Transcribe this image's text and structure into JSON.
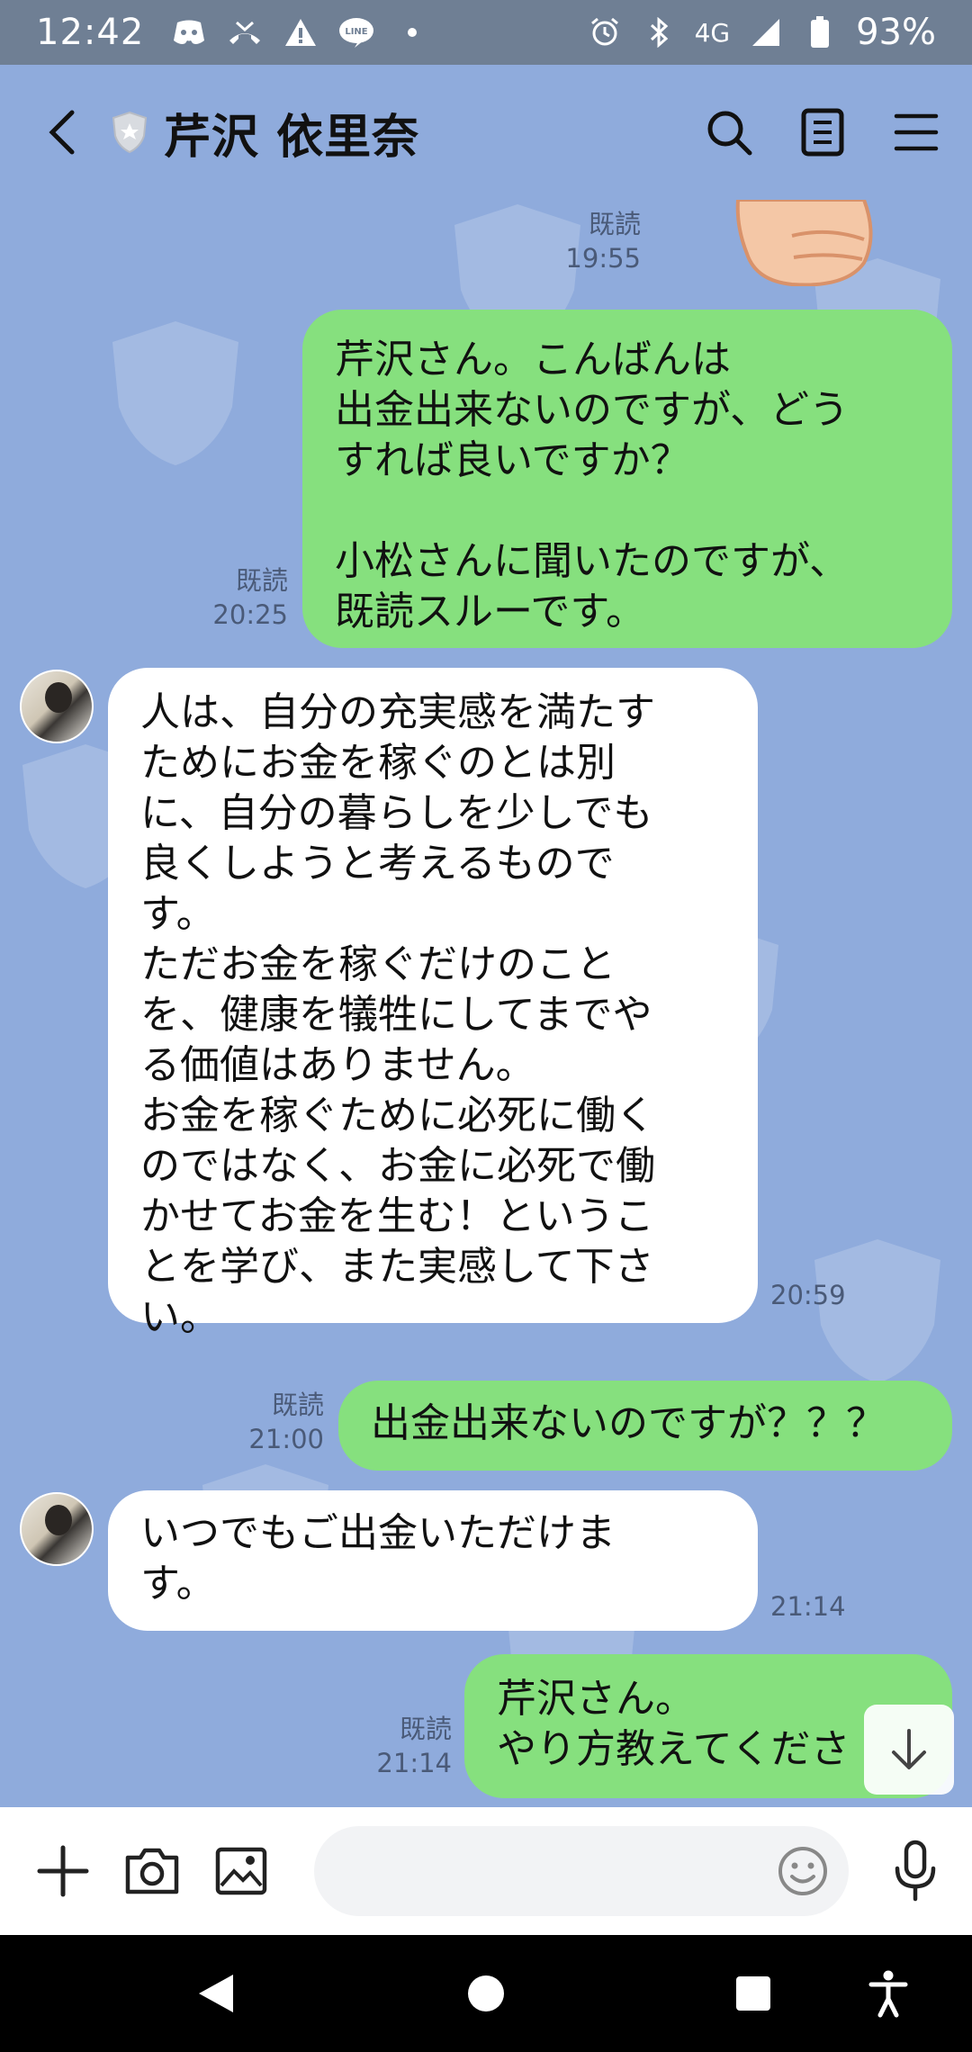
{
  "status_bar": {
    "time": "12:42",
    "network": "4G",
    "battery": "93%",
    "left_icons": [
      "discord-icon",
      "missed-call-icon",
      "warning-icon",
      "line-icon",
      "dot-icon"
    ],
    "right_icons": [
      "alarm-icon",
      "bluetooth-icon",
      "signal-icon",
      "battery-icon"
    ]
  },
  "header": {
    "title": "芹沢 依里奈",
    "actions": [
      "search-icon",
      "notes-icon",
      "menu-icon"
    ]
  },
  "messages": [
    {
      "side": "out",
      "read": "既読",
      "time": "19:55",
      "text": ""
    },
    {
      "side": "out",
      "read": "既読",
      "time": "20:25",
      "text": "芹沢さん。こんばんは\n出金出来ないのですが、どう\nすれば良いですか？\n\n小松さんに聞いたのですが、\n既読スルーです。"
    },
    {
      "side": "in",
      "time": "20:59",
      "text": "人は、自分の充実感を満たす\nためにお金を稼ぐのとは別\nに、自分の暮らしを少しでも\n良くしようと考えるもので\nす。\nただお金を稼ぐだけのこと\nを、健康を犠牲にしてまでや\nる価値はありません。\nお金を稼ぐために必死に働く\nのではなく、お金に必死で働\nかせてお金を生む！というこ\nとを学び、また実感して下さ\nい。"
    },
    {
      "side": "out",
      "read": "既読",
      "time": "21:00",
      "text": "出金出来ないのですが？？？"
    },
    {
      "side": "in",
      "time": "21:14",
      "text": "いつでもご出金いただけま\nす。"
    },
    {
      "side": "out",
      "read": "既読",
      "time": "21:14",
      "text": "芹沢さん。\nやり方教えてくださ"
    }
  ],
  "input_bar": {
    "placeholder": "",
    "icons": [
      "plus-icon",
      "camera-icon",
      "image-icon",
      "emoji-icon",
      "mic-icon"
    ]
  },
  "nav_bar": {
    "icons": [
      "back-triangle-icon",
      "home-circle-icon",
      "recents-square-icon",
      "accessibility-icon"
    ]
  },
  "colors": {
    "chat_bg": "#8fabdc",
    "outgoing_bubble": "#86e07e",
    "incoming_bubble": "#ffffff",
    "status_bar": "#6f7f94"
  }
}
